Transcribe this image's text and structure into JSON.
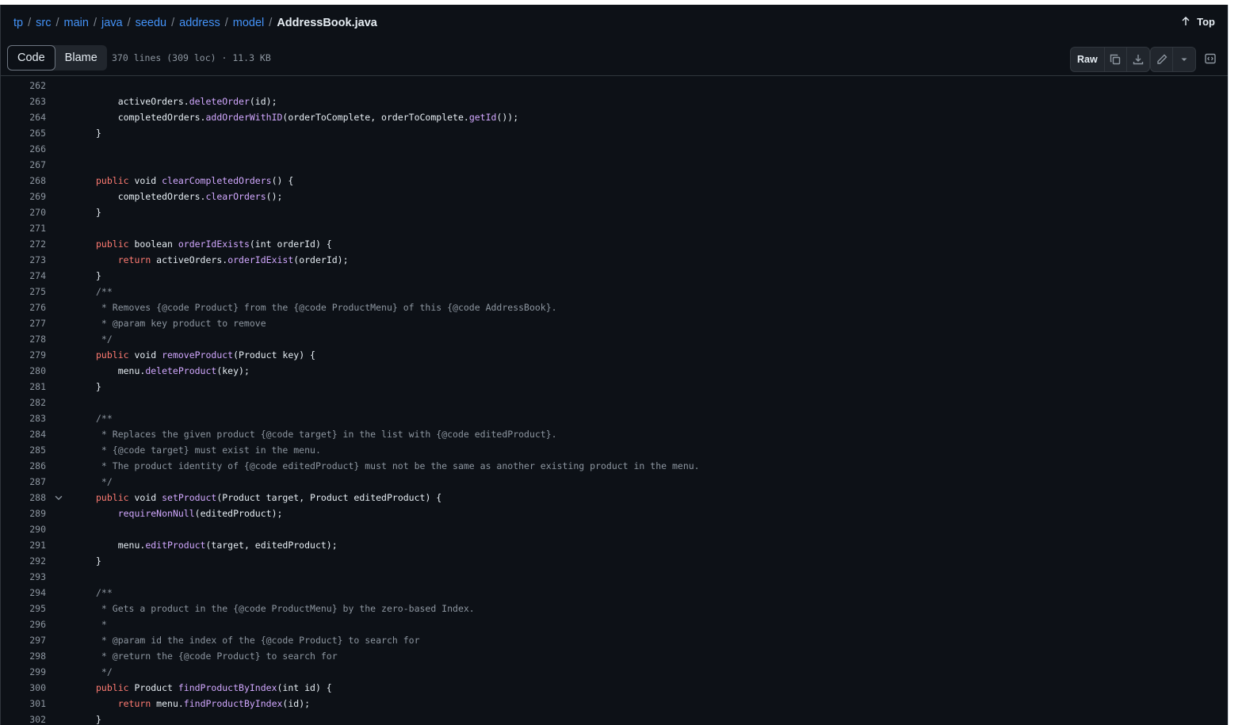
{
  "breadcrumb": {
    "parts": [
      "tp",
      "src",
      "main",
      "java",
      "seedu",
      "address",
      "model"
    ],
    "current": "AddressBook.java",
    "top_label": "Top"
  },
  "toolbar": {
    "code_tab": "Code",
    "blame_tab": "Blame",
    "file_meta": "370 lines (309 loc) · 11.3 KB",
    "raw_label": "Raw"
  },
  "icons": {
    "top": "arrow-up-icon",
    "copy": "copy-icon",
    "download": "download-icon",
    "edit": "pencil-icon",
    "more": "triangle-down-icon",
    "symbols": "code-square-icon",
    "fold": "chevron-down-icon"
  },
  "colors": {
    "background": "#0d1117",
    "keyword": "#ff7b72",
    "function": "#d2a8ff",
    "comment": "#8d96a0",
    "link": "#4493f8"
  },
  "code": {
    "lines": [
      {
        "n": "262",
        "t": ""
      },
      {
        "n": "263",
        "t": "    activeOrders.deleteOrder(id);"
      },
      {
        "n": "264",
        "t": "    completedOrders.addOrderWithID(orderToComplete, orderToComplete.getId());"
      },
      {
        "n": "265",
        "t": "}"
      },
      {
        "n": "266",
        "t": ""
      },
      {
        "n": "267",
        "t": ""
      },
      {
        "n": "268",
        "t": "public void clearCompletedOrders() {"
      },
      {
        "n": "269",
        "t": "    completedOrders.clearOrders();"
      },
      {
        "n": "270",
        "t": "}"
      },
      {
        "n": "271",
        "t": ""
      },
      {
        "n": "272",
        "t": "public boolean orderIdExists(int orderId) {"
      },
      {
        "n": "273",
        "t": "    return activeOrders.orderIdExist(orderId);"
      },
      {
        "n": "274",
        "t": "}"
      },
      {
        "n": "275",
        "t": "/**"
      },
      {
        "n": "276",
        "t": " * Removes {@code Product} from the {@code ProductMenu} of this {@code AddressBook}."
      },
      {
        "n": "277",
        "t": " * @param key product to remove"
      },
      {
        "n": "278",
        "t": " */"
      },
      {
        "n": "279",
        "t": "public void removeProduct(Product key) {"
      },
      {
        "n": "280",
        "t": "    menu.deleteProduct(key);"
      },
      {
        "n": "281",
        "t": "}"
      },
      {
        "n": "282",
        "t": ""
      },
      {
        "n": "283",
        "t": "/**"
      },
      {
        "n": "284",
        "t": " * Replaces the given product {@code target} in the list with {@code editedProduct}."
      },
      {
        "n": "285",
        "t": " * {@code target} must exist in the menu."
      },
      {
        "n": "286",
        "t": " * The product identity of {@code editedProduct} must not be the same as another existing product in the menu."
      },
      {
        "n": "287",
        "t": " */"
      },
      {
        "n": "288",
        "t": "public void setProduct(Product target, Product editedProduct) {"
      },
      {
        "n": "289",
        "t": "    requireNonNull(editedProduct);"
      },
      {
        "n": "290",
        "t": ""
      },
      {
        "n": "291",
        "t": "    menu.editProduct(target, editedProduct);"
      },
      {
        "n": "292",
        "t": "}"
      },
      {
        "n": "293",
        "t": ""
      },
      {
        "n": "294",
        "t": "/**"
      },
      {
        "n": "295",
        "t": " * Gets a product in the {@code ProductMenu} by the zero-based Index."
      },
      {
        "n": "296",
        "t": " *"
      },
      {
        "n": "297",
        "t": " * @param id the index of the {@code Product} to search for"
      },
      {
        "n": "298",
        "t": " * @return the {@code Product} to search for"
      },
      {
        "n": "299",
        "t": " */"
      },
      {
        "n": "300",
        "t": "public Product findProductByIndex(int id) {"
      },
      {
        "n": "301",
        "t": "    return menu.findProductByIndex(id);"
      },
      {
        "n": "302",
        "t": "}"
      }
    ]
  }
}
